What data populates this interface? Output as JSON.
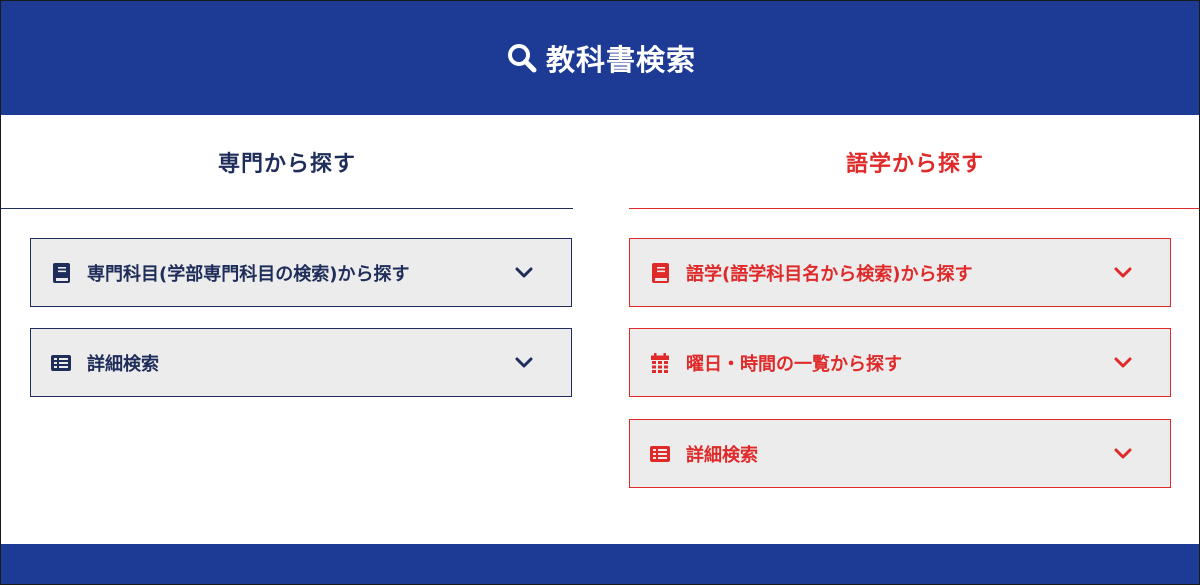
{
  "header": {
    "title": "教科書検索",
    "icon": "search-icon"
  },
  "left": {
    "heading": "専門から探す",
    "items": [
      {
        "label": "専門科目(学部専門科目の検索)から探す",
        "icon": "book-icon"
      },
      {
        "label": "詳細検索",
        "icon": "list-icon"
      }
    ]
  },
  "right": {
    "heading": "語学から探す",
    "items": [
      {
        "label": "語学(語学科目名から検索)から探す",
        "icon": "book-icon"
      },
      {
        "label": "曜日・時間の一覧から探す",
        "icon": "calendar-icon"
      },
      {
        "label": "詳細検索",
        "icon": "list-icon"
      }
    ]
  },
  "colors": {
    "brand_blue": "#1d3b95",
    "navy_text": "#1f2d5a",
    "accent_red": "#e02a2a",
    "item_bg": "#ececec"
  }
}
